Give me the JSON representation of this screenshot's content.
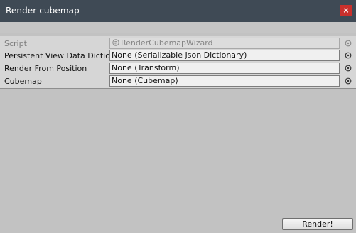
{
  "window": {
    "title": "Render cubemap",
    "close_glyph": "×"
  },
  "fields": [
    {
      "label": "Script",
      "value": "RenderCubemapWizard",
      "disabled": true,
      "icon": "script-icon"
    },
    {
      "label": "Persistent View Data Dictionary",
      "value": "None (Serializable Json Dictionary)",
      "disabled": false,
      "icon": "object-picker-icon"
    },
    {
      "label": "Render From Position",
      "value": "None (Transform)",
      "disabled": false,
      "icon": "object-picker-icon"
    },
    {
      "label": "Cubemap",
      "value": "None (Cubemap)",
      "disabled": false,
      "icon": "object-picker-icon"
    }
  ],
  "footer": {
    "render_label": "Render!"
  },
  "colors": {
    "titlebar": "#3f4a55",
    "close_button": "#c9302c",
    "background": "#c2c2c2"
  }
}
